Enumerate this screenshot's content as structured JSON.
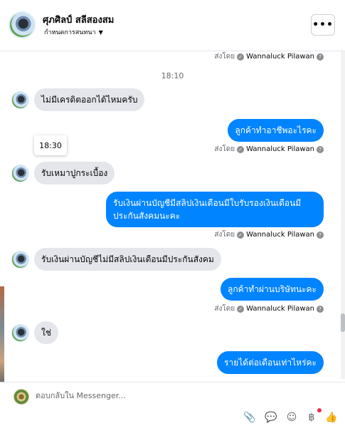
{
  "header": {
    "contact_name": "ศุภศิลป์ สลีสองสม",
    "manage_label": "กำหนดการสนทนา",
    "more_glyph": "•••"
  },
  "chat": {
    "top_sent_by": {
      "prefix": "ส่งโดย",
      "name": "Wannaluck Pilawan"
    },
    "time_1810": "18:10",
    "time_1830": "18:30",
    "messages": [
      {
        "text": "ไม่มีเครดิตออกได้ไหมครับ"
      },
      {
        "text": "ลูกค้าทำอาชีพอะไรคะ",
        "prefix": "ส่งโดย",
        "name": "Wannaluck Pilawan"
      },
      {
        "text": "รับเหมาปูกระเบื้อง"
      },
      {
        "text": "รับเงินผ่านบัญชีมีสลิปเงินเดือนมีใบรับรองเงินเดือนมีประกันสังคมนะคะ",
        "prefix": "ส่งโดย",
        "name": "Wannaluck Pilawan"
      },
      {
        "text": "รับเงินผ่านบัญชีไม่มีสลิปเงินเดือนมีประกันสังคม"
      },
      {
        "text": "ลูกค้าทำผ่านบริษัทนะคะ",
        "prefix": "ส่งโดย",
        "name": "Wannaluck Pilawan"
      },
      {
        "text": "ใช่"
      },
      {
        "text": "รายได้ต่อเดือนเท่าไหร่คะ"
      }
    ]
  },
  "composer": {
    "placeholder": "ตอบกลับใน Messenger..."
  },
  "icons": {
    "check": "✓",
    "info": "?",
    "attach": "📎",
    "quick_reply": "💬",
    "emoji": "☺",
    "currency": "฿",
    "like": "👍"
  },
  "colors": {
    "sent_bubble": "#0084ff",
    "received_bubble": "#e4e6eb",
    "notification_dot": "#f02849"
  }
}
